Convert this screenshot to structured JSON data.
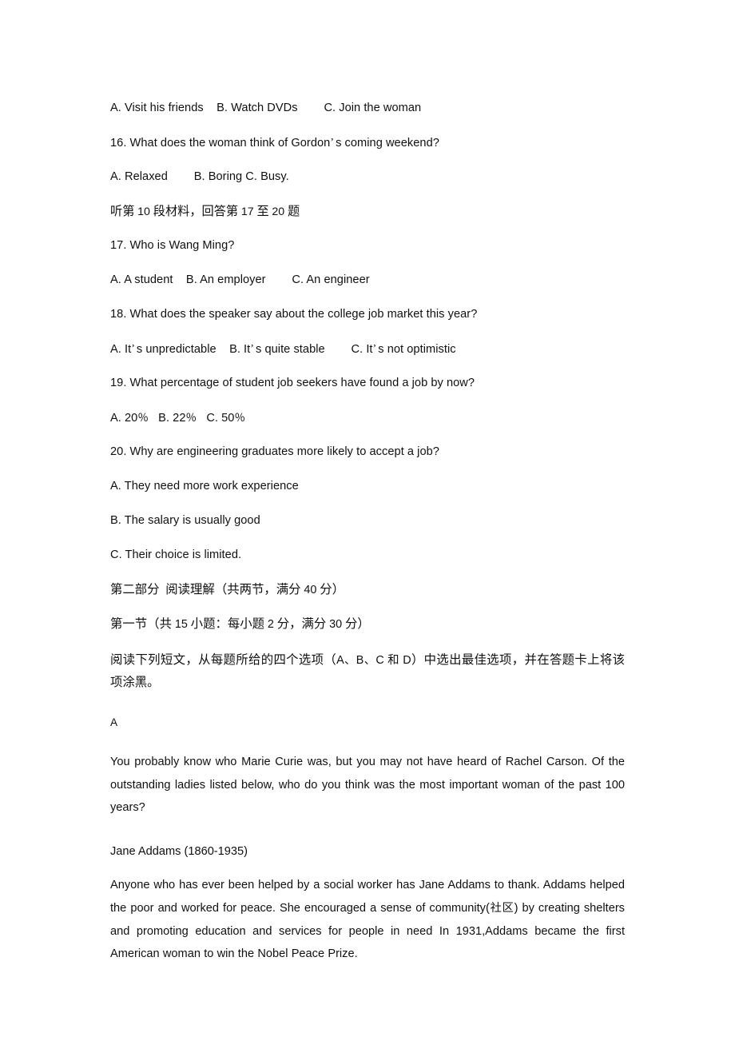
{
  "document": {
    "type": "exam-paper",
    "language": "zh-CN/en",
    "listening": {
      "q15_options": "A. Visit his friends    B. Watch DVDs        C. Join the woman",
      "q16": {
        "stem_before": "16. What does the woman think of Gordon",
        "apostrophe": "’",
        "stem_after": "s coming weekend?",
        "options": "A. Relaxed        B. Boring C. Busy."
      },
      "material_directive": {
        "part1": "听第 ",
        "num1": "10",
        "part2": " 段材料，回答第 ",
        "num2": "17",
        "part3": " 至 ",
        "num3": "20",
        "part4": " 题"
      },
      "q17": {
        "stem": "17. Who is Wang Ming?",
        "options": "A. A student    B. An employer        C. An engineer"
      },
      "q18": {
        "stem": "18. What does the speaker say about the college job market this year?",
        "opt_a_before": "A. It",
        "opt_a_after": "s unpredictable    B. It",
        "opt_b_after": "s quite stable        C. It",
        "opt_c_after": "s not optimistic",
        "apostrophe": "’"
      },
      "q19": {
        "stem": "19. What percentage of student job seekers have found a job by now?",
        "opt_a_num": "A. 20",
        "opt_b_num": "B. 22",
        "opt_c_num": "C. 50",
        "percent": "％"
      },
      "q20": {
        "stem": "20. Why are engineering graduates more likely to accept a job?",
        "option_a": "A. They need more work experience",
        "option_b": "B. The salary is usually good",
        "option_c": "C. Their choice is limited."
      }
    },
    "part_two": {
      "heading": {
        "before": "第二部分  阅读理解（共两节，满分 ",
        "score": "40",
        "after": " 分）"
      },
      "section_one": {
        "p1": "第一节（共 ",
        "n1": "15",
        "p2": " 小题：每小题 ",
        "n2": "2",
        "p3": " 分，满分 ",
        "n3": "30",
        "p4": " 分）"
      },
      "instruction": {
        "seg1": "阅读下列短文，从每题所给的四个选项（",
        "letters": "A、B、C 和 D",
        "seg2": "）中选出最佳选项，并在答题卡上将该项涂黑。"
      },
      "passage_a": {
        "label": "A",
        "intro": "You probably know who Marie Curie was, but you may not have heard of Rachel Carson. Of the outstanding ladies listed below, who do you think was the most important woman of the past 100 years?",
        "entry_heading": "Jane Addams (1860-1935)",
        "entry_text_1": "Anyone who has ever been helped by a social worker has Jane Addams to thank. Addams helped the poor and worked for peace. She encouraged a sense of community(",
        "entry_gloss": "社区",
        "entry_text_2": ") by creating shelters and promoting education and services for people in need In 1931,Addams became the first American woman to win the Nobel Peace Prize."
      }
    }
  }
}
